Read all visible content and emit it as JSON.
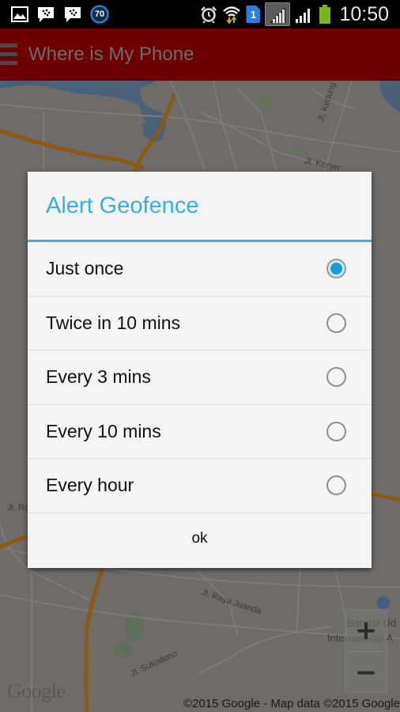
{
  "status_bar": {
    "left_icons": [
      "gallery-icon",
      "bbm-icon",
      "bbm-icon",
      "battery-percent-badge"
    ],
    "battery_badge": "70",
    "right_icons": [
      "alarm-icon",
      "wifi-icon",
      "sim1-icon",
      "signal-icon",
      "signal-icon",
      "battery-icon"
    ],
    "sim_label": "1",
    "time": "10:50"
  },
  "app_bar": {
    "title": "Where is My Phone",
    "menu_icon": "hamburger-menu-icon",
    "color": "#6c0000"
  },
  "map": {
    "labels": {
      "jl_kedung_cowek": "Jl. Kedung Cowek",
      "jl_kenjeran": "Jl. Kenjer",
      "jl_raya": "Jl. Ra",
      "jl_raya_juanda": "Jl. Raya Juanda",
      "jl_sukodono": "Jl. Sukodono",
      "bandar_line1": "Bandar Ud",
      "bandar_line2": "International A"
    },
    "google_logo": "Google",
    "copyright": "©2015 Google - Map data ©2015 Google",
    "zoom_in": "+",
    "zoom_out": "−"
  },
  "dialog": {
    "title": "Alert Geofence",
    "accent_color": "#35b1e0",
    "options": [
      {
        "label": "Just once",
        "checked": true
      },
      {
        "label": "Twice in 10 mins",
        "checked": false
      },
      {
        "label": "Every 3 mins",
        "checked": false
      },
      {
        "label": "Every 10 mins",
        "checked": false
      },
      {
        "label": "Every hour",
        "checked": false
      }
    ],
    "ok_label": "ok"
  }
}
